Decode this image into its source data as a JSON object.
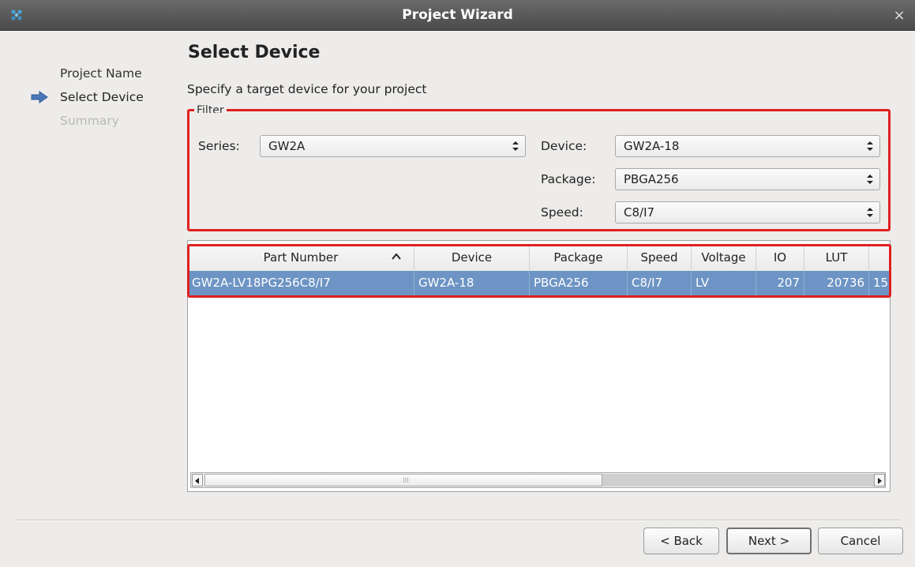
{
  "window": {
    "title": "Project Wizard",
    "close_glyph": "×"
  },
  "steps": [
    {
      "label": "Project Name",
      "state": "done"
    },
    {
      "label": "Select Device",
      "state": "current",
      "icon": "arrow-right-icon"
    },
    {
      "label": "Summary",
      "state": "pending"
    }
  ],
  "page": {
    "heading": "Select Device",
    "subtitle": "Specify a target device for your project"
  },
  "filter": {
    "legend": "Filter",
    "series": {
      "label": "Series:",
      "value": "GW2A"
    },
    "device": {
      "label": "Device:",
      "value": "GW2A-18"
    },
    "package": {
      "label": "Package:",
      "value": "PBGA256"
    },
    "speed": {
      "label": "Speed:",
      "value": "C8/I7"
    }
  },
  "table": {
    "columns": [
      "Part Number",
      "Device",
      "Package",
      "Speed",
      "Voltage",
      "IO",
      "LUT",
      ""
    ],
    "sorted_column": "Part Number",
    "rows": [
      [
        "GW2A-LV18PG256C8/I7",
        "GW2A-18",
        "PBGA256",
        "C8/I7",
        "LV",
        "207",
        "20736",
        "15"
      ]
    ],
    "selected_row": 0,
    "scroll": {
      "left_glyph": "◀",
      "right_glyph": "▶",
      "grip": "III"
    }
  },
  "buttons": {
    "back": "< Back",
    "next": "Next >",
    "cancel": "Cancel"
  },
  "colors": {
    "selection": "#6d94c4",
    "highlight": "#e02020",
    "titlebar": "#555555"
  }
}
